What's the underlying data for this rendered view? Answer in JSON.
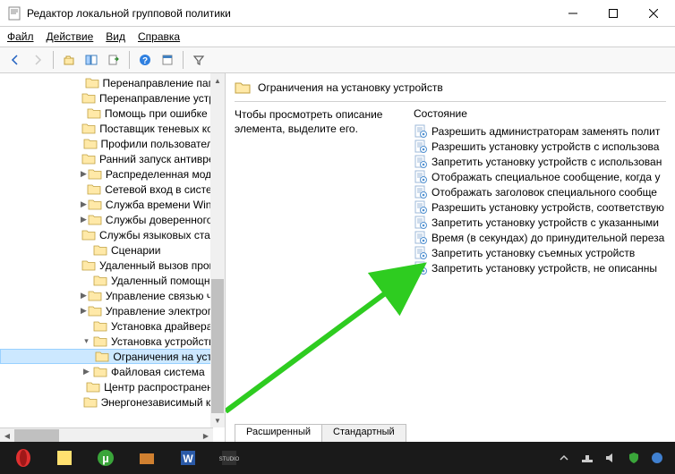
{
  "window": {
    "title": "Редактор локальной групповой политики"
  },
  "menu": {
    "file": "Файл",
    "action": "Действие",
    "view": "Вид",
    "help": "Справка"
  },
  "tree": {
    "items": [
      {
        "label": "Перенаправление папок",
        "indent": 3,
        "tw": ""
      },
      {
        "label": "Перенаправление устрой",
        "indent": 3,
        "tw": ""
      },
      {
        "label": "Помощь при ошибке «О",
        "indent": 3,
        "tw": ""
      },
      {
        "label": "Поставщик теневых копи",
        "indent": 3,
        "tw": ""
      },
      {
        "label": "Профили пользователей",
        "indent": 3,
        "tw": ""
      },
      {
        "label": "Ранний запуск антивредс",
        "indent": 3,
        "tw": ""
      },
      {
        "label": "Распределенная модель",
        "indent": 3,
        "tw": ">"
      },
      {
        "label": "Сетевой вход в систему",
        "indent": 3,
        "tw": ""
      },
      {
        "label": "Служба времени Window",
        "indent": 3,
        "tw": ">"
      },
      {
        "label": "Службы доверенного пл",
        "indent": 3,
        "tw": ">"
      },
      {
        "label": "Службы языковых станда",
        "indent": 3,
        "tw": ""
      },
      {
        "label": "Сценарии",
        "indent": 3,
        "tw": ""
      },
      {
        "label": "Удаленный вызов процед",
        "indent": 3,
        "tw": ""
      },
      {
        "label": "Удаленный помощник",
        "indent": 3,
        "tw": ""
      },
      {
        "label": "Управление связью чере",
        "indent": 3,
        "tw": ">"
      },
      {
        "label": "Управление электропита",
        "indent": 3,
        "tw": ">"
      },
      {
        "label": "Установка драйвера",
        "indent": 3,
        "tw": ""
      },
      {
        "label": "Установка устройства",
        "indent": 3,
        "tw": "v",
        "expanded": true
      },
      {
        "label": "Ограничения на устан",
        "indent": 4,
        "tw": "",
        "selected": true
      },
      {
        "label": "Файловая система",
        "indent": 3,
        "tw": ">"
      },
      {
        "label": "Центр распространения",
        "indent": 3,
        "tw": ""
      },
      {
        "label": "Энергонезависимый кэш",
        "indent": 3,
        "tw": ""
      }
    ]
  },
  "detail": {
    "heading": "Ограничения на установку устройств",
    "description": "Чтобы просмотреть описание элемента, выделите его.",
    "column_header": "Состояние",
    "policies": [
      "Разрешить администраторам заменять полит",
      "Разрешить установку устройств с использова",
      "Запретить установку устройств с использован",
      "Отображать специальное сообщение, когда у",
      "Отображать заголовок специального сообще",
      "Разрешить установку устройств, соответствую",
      "Запретить установку устройств с указанными",
      "Время (в секундах) до принудительной переза",
      "Запретить установку съемных устройств",
      "Запретить установку устройств, не описанны"
    ]
  },
  "tabs": {
    "extended": "Расширенный",
    "standard": "Стандартный"
  }
}
